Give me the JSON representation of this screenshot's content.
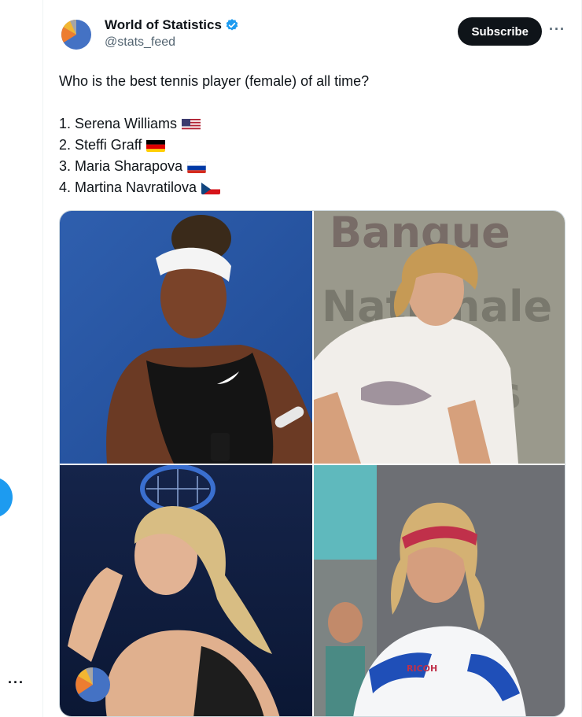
{
  "post": {
    "author": {
      "display_name": "World of Statistics",
      "handle": "@stats_feed",
      "verified": true,
      "avatar_icon": "pie-chart-logo"
    },
    "subscribe_label": "Subscribe",
    "more_label": "···",
    "text": {
      "question": "Who is the best tennis player (female) of all time?",
      "ranking": [
        {
          "label": "1. Serena Williams",
          "flag": "us-flag-icon"
        },
        {
          "label": "2. Steffi Graff",
          "flag": "de-flag-icon"
        },
        {
          "label": "3. Maria Sharapova",
          "flag": "ru-flag-icon"
        },
        {
          "label": "4. Martina Navratilova",
          "flag": "cz-flag-icon"
        }
      ]
    },
    "media": {
      "photos": [
        {
          "subject": "serena-williams-photo",
          "background_text": ""
        },
        {
          "subject": "steffi-graf-photo",
          "background_text": "Banque Nationale Paris"
        },
        {
          "subject": "maria-sharapova-photo",
          "background_text": ""
        },
        {
          "subject": "martina-navratilova-photo",
          "background_text": ""
        }
      ]
    }
  },
  "left_rail": {
    "more_label": "···"
  },
  "colors": {
    "brand_blue": "#1d9bf0",
    "text_primary": "#0f1419",
    "text_secondary": "#536471",
    "border": "#cfd9de"
  }
}
